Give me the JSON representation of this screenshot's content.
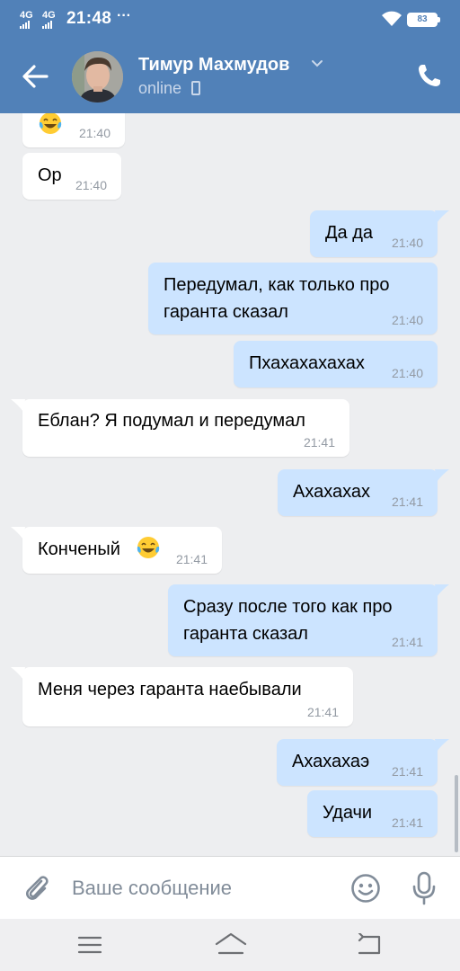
{
  "status_bar": {
    "net1": "4G",
    "net2": "4G",
    "time": "21:48",
    "dots": "···",
    "battery": "83"
  },
  "header": {
    "name": "Тимур Махмудов",
    "status": "online"
  },
  "messages": [
    {
      "side": "in",
      "text": "",
      "emoji": "tears-of-joy",
      "time": "21:40"
    },
    {
      "side": "in",
      "text": "Ор",
      "time": "21:40"
    },
    {
      "side": "out",
      "text": "Да да",
      "time": "21:40"
    },
    {
      "side": "out",
      "line1": "Передумал, как только про",
      "line2": "гаранта сказал",
      "time": "21:40"
    },
    {
      "side": "out",
      "text": "Пхахахахахах",
      "time": "21:40"
    },
    {
      "side": "in",
      "text": "Еблан? Я подумал и передумал",
      "time": "21:41"
    },
    {
      "side": "out",
      "text": "Ахахахах",
      "time": "21:41"
    },
    {
      "side": "in",
      "text": "Конченый",
      "emoji": "tears-of-joy",
      "time": "21:41"
    },
    {
      "side": "out",
      "line1": "Сразу после того как про",
      "line2": "гаранта сказал",
      "time": "21:41"
    },
    {
      "side": "in",
      "text": "Меня через гаранта наебывали",
      "time": "21:41"
    },
    {
      "side": "out",
      "text": "Ахахахаэ",
      "time": "21:41"
    },
    {
      "side": "out",
      "text": "Удачи",
      "time": "21:41"
    }
  ],
  "composer": {
    "placeholder": "Ваше сообщение"
  },
  "colors": {
    "header_bg": "#5181b8",
    "outgoing_bubble": "#cce4ff",
    "incoming_bubble": "#ffffff",
    "chat_bg": "#edeef0"
  },
  "icons": {
    "back": "arrow-left-icon",
    "call": "phone-icon",
    "attach": "paperclip-icon",
    "sticker": "smile-icon",
    "voice": "microphone-icon"
  }
}
